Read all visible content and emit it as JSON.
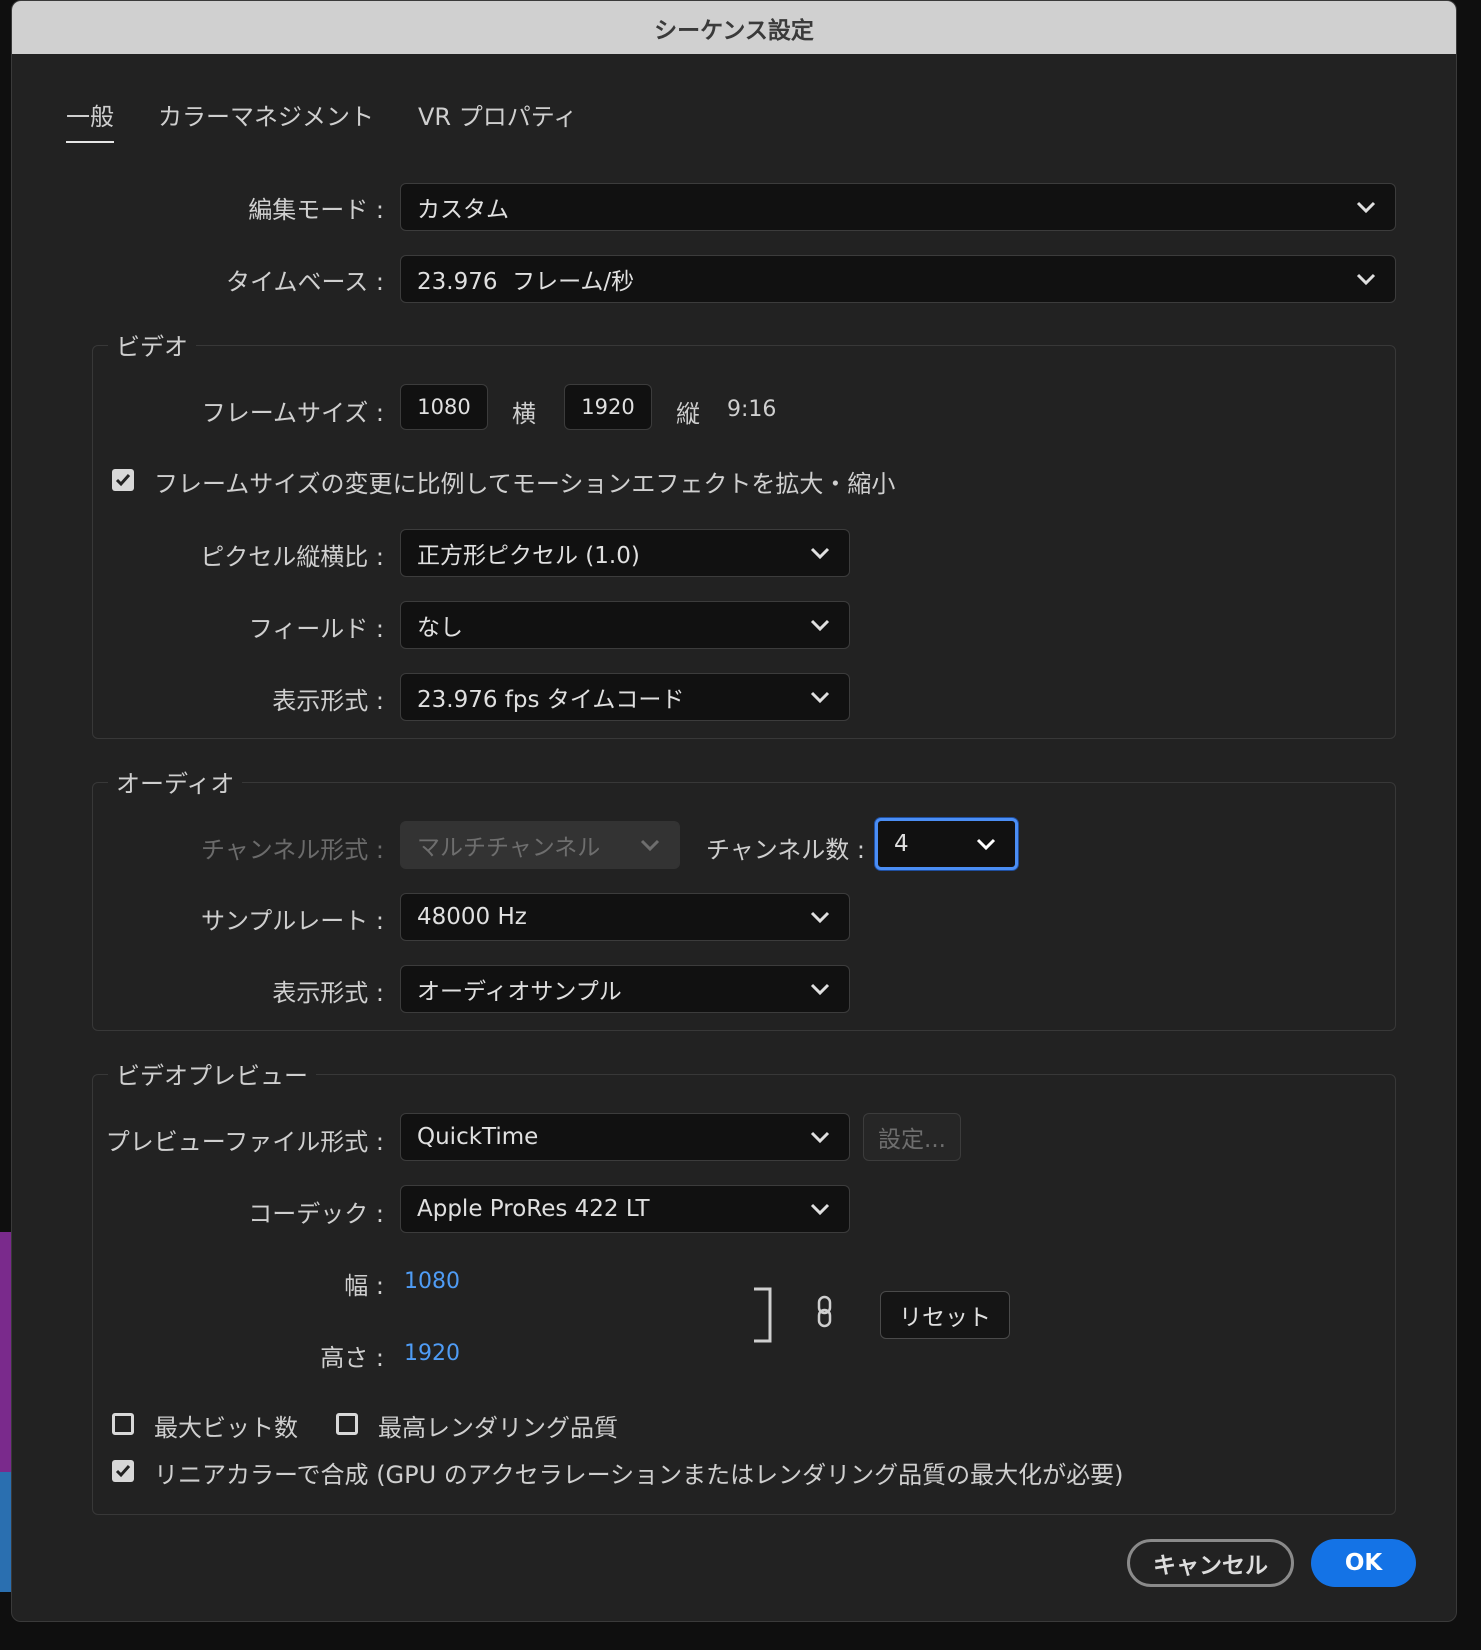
{
  "window": {
    "title": "シーケンス設定"
  },
  "tabs": [
    {
      "label": "一般",
      "active": true
    },
    {
      "label": "カラーマネジメント",
      "active": false
    },
    {
      "label": "VR プロパティ",
      "active": false
    }
  ],
  "general": {
    "edit_mode": {
      "label": "編集モード :",
      "value": "カスタム"
    },
    "timebase": {
      "label": "タイムベース :",
      "value": "23.976  フレーム/秒"
    }
  },
  "video": {
    "title": "ビデオ",
    "frame_size": {
      "label": "フレームサイズ :",
      "width": "1080",
      "width_unit": "横",
      "height": "1920",
      "height_unit": "縦",
      "ratio": "9:16"
    },
    "scale_checkbox": {
      "label": "フレームサイズの変更に比例してモーションエフェクトを拡大・縮小",
      "checked": true
    },
    "pixel_aspect": {
      "label": "ピクセル縦横比 :",
      "value": "正方形ピクセル (1.0)"
    },
    "fields": {
      "label": "フィールド :",
      "value": "なし"
    },
    "display_format": {
      "label": "表示形式 :",
      "value": "23.976 fps タイムコード"
    }
  },
  "audio": {
    "title": "オーディオ",
    "channel_format": {
      "label": "チャンネル形式 :",
      "value": "マルチチャンネル"
    },
    "channel_count": {
      "label": "チャンネル数 :",
      "value": "4"
    },
    "sample_rate": {
      "label": "サンプルレート :",
      "value": "48000 Hz"
    },
    "display_format": {
      "label": "表示形式 :",
      "value": "オーディオサンプル"
    }
  },
  "preview": {
    "title": "ビデオプレビュー",
    "file_format": {
      "label": "プレビューファイル形式 :",
      "value": "QuickTime"
    },
    "settings_button": "設定...",
    "codec": {
      "label": "コーデック :",
      "value": "Apple ProRes 422 LT"
    },
    "width": {
      "label": "幅 :",
      "value": "1080"
    },
    "height": {
      "label": "高さ :",
      "value": "1920"
    },
    "reset_button": "リセット",
    "max_bit_depth": {
      "label": "最大ビット数",
      "checked": false
    },
    "max_render_quality": {
      "label": "最高レンダリング品質",
      "checked": false
    },
    "linear_color": {
      "label": "リニアカラーで合成 (GPU のアクセラレーションまたはレンダリング品質の最大化が必要)",
      "checked": true
    }
  },
  "footer": {
    "cancel": "キャンセル",
    "ok": "OK"
  },
  "colors": {
    "accent": "#1473e6",
    "link": "#4f9cf5",
    "focus": "#4b8ef5",
    "panel": "#222222",
    "titlebar": "#d0d0d0"
  }
}
